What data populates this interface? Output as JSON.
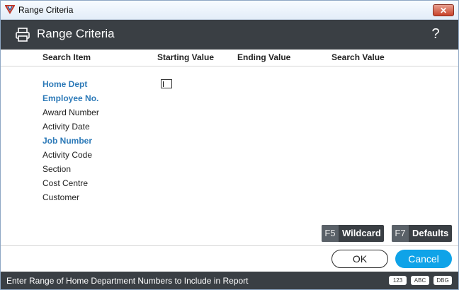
{
  "window": {
    "title": "Range Criteria",
    "close_label": "✕"
  },
  "header": {
    "title": "Range Criteria",
    "help_glyph": "?"
  },
  "columns": {
    "search_item": "Search Item",
    "starting_value": "Starting Value",
    "ending_value": "Ending Value",
    "search_value": "Search Value"
  },
  "fields": [
    {
      "label": "Home Dept",
      "highlighted": true
    },
    {
      "label": "Employee No.",
      "highlighted": true
    },
    {
      "label": "Award Number",
      "highlighted": false
    },
    {
      "label": "Activity Date",
      "highlighted": false
    },
    {
      "label": "Job Number",
      "highlighted": true
    },
    {
      "label": "Activity Code",
      "highlighted": false
    },
    {
      "label": "Section",
      "highlighted": false
    },
    {
      "label": "Cost Centre",
      "highlighted": false
    },
    {
      "label": "Customer",
      "highlighted": false
    }
  ],
  "starting_value_input": "",
  "function_keys": [
    {
      "key": "F5",
      "label": "Wildcard"
    },
    {
      "key": "F7",
      "label": "Defaults"
    }
  ],
  "buttons": {
    "ok": "OK",
    "cancel": "Cancel"
  },
  "status": {
    "message": "Enter Range of Home Department Numbers to Include in Report",
    "badges": [
      "123",
      "ABC",
      "DBG"
    ]
  },
  "colors": {
    "header_bg": "#3a3f44",
    "highlight_text": "#2d7ab8",
    "cancel_bg": "#0fa3e8"
  },
  "icons": {
    "app": "app-logo-icon",
    "printer": "printer-icon",
    "help": "help-icon",
    "close": "close-icon"
  }
}
